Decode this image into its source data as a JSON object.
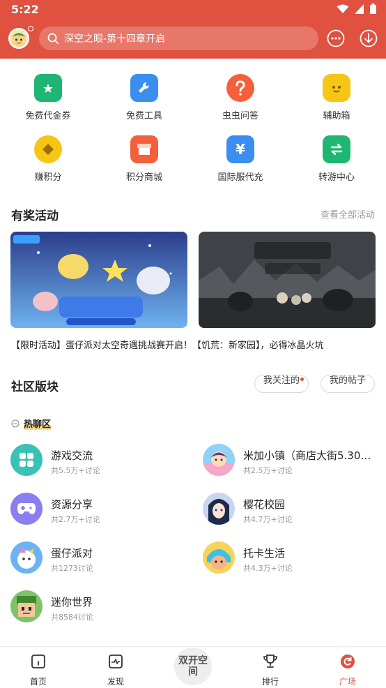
{
  "status": {
    "time": "5:22"
  },
  "header": {
    "search_text": "深空之眼-第十四章开启"
  },
  "quick_grid": [
    {
      "label": "免费代金券",
      "icon": "coupon-icon",
      "color": "#1fb673"
    },
    {
      "label": "免费工具",
      "icon": "toolbox-icon",
      "color": "#3a8ef0"
    },
    {
      "label": "虫虫问答",
      "icon": "question-icon",
      "color": "#f5603c"
    },
    {
      "label": "辅助箱",
      "icon": "robot-icon",
      "color": "#f6c614"
    },
    {
      "label": "赚积分",
      "icon": "coin-icon",
      "color": "#f6c614"
    },
    {
      "label": "积分商城",
      "icon": "shop-icon",
      "color": "#f5603c"
    },
    {
      "label": "国际服代充",
      "icon": "yen-icon",
      "color": "#3a8ef0"
    },
    {
      "label": "转游中心",
      "icon": "transfer-icon",
      "color": "#1fb673"
    }
  ],
  "activities": {
    "title": "有奖活动",
    "view_all": "查看全部活动",
    "text": "【限时活动】蛋仔派对太空奇遇挑战赛开启！【饥荒：新家园】，必得冰晶火坑"
  },
  "community": {
    "title": "社区版块",
    "following": "我关注的",
    "my_posts": "我的帖子",
    "hot_label": "热聊区",
    "forums": [
      {
        "name": "游戏交流",
        "meta": "共5.5万+讨论"
      },
      {
        "name": "米加小镇（商店大街5.30…",
        "meta": "共2.5万+讨论"
      },
      {
        "name": "资源分享",
        "meta": "共2.7万+讨论"
      },
      {
        "name": "樱花校园",
        "meta": "共4.7万+讨论"
      },
      {
        "name": "蛋仔派对",
        "meta": "共1273讨论"
      },
      {
        "name": "托卡生活",
        "meta": "共4.3万+讨论"
      },
      {
        "name": "迷你世界",
        "meta": "共8584讨论"
      }
    ]
  },
  "bottom_nav": {
    "home": "首页",
    "discover": "发现",
    "center": "双开空间",
    "rank": "排行",
    "plaza": "广场"
  },
  "colors": {
    "brand": "#e0513f",
    "active": "#e0513f"
  }
}
